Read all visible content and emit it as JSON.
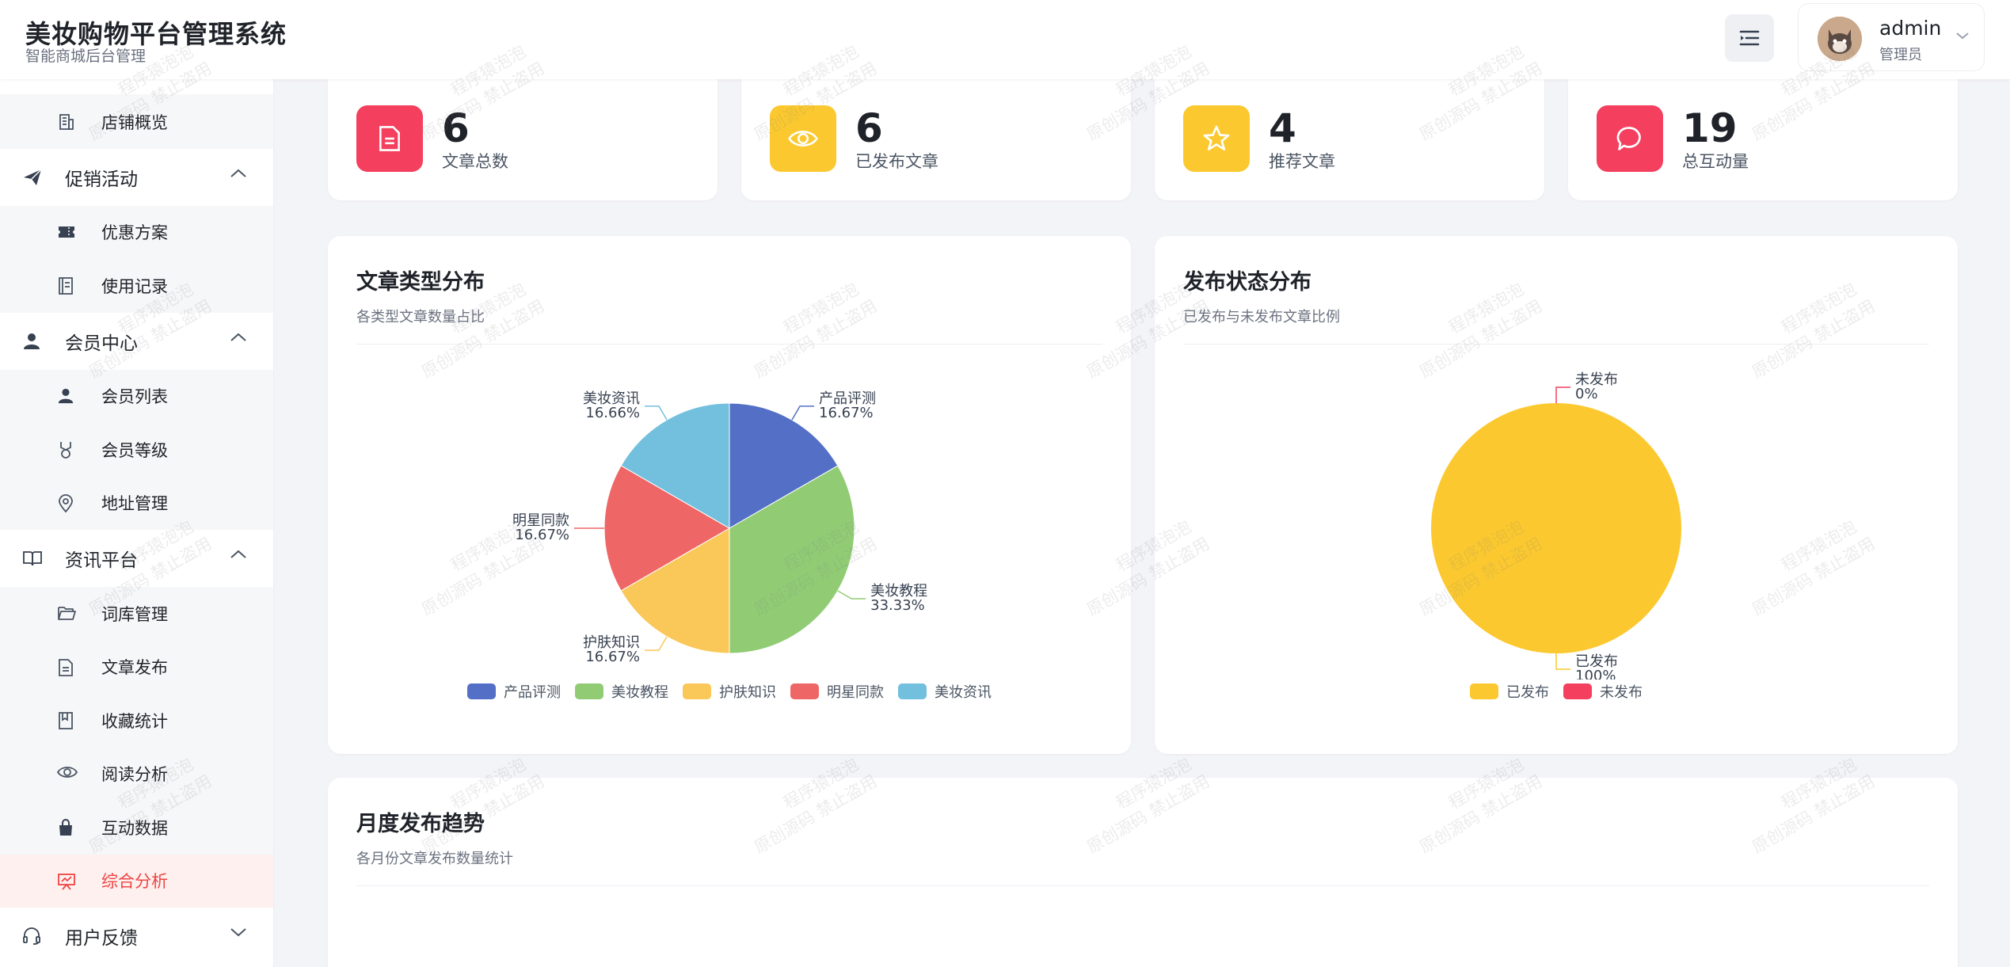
{
  "header": {
    "title": "美妆购物平台管理系统",
    "subtitle": "智能商城后台管理",
    "user_name": "admin",
    "user_role": "管理员"
  },
  "sidebar": {
    "partial_item": {
      "label": "店铺概览",
      "icon": "building-icon"
    },
    "groups": [
      {
        "label": "促销活动",
        "icon": "send-icon",
        "expanded": true,
        "items": [
          {
            "label": "优惠方案",
            "icon": "ticket-icon"
          },
          {
            "label": "使用记录",
            "icon": "record-icon"
          }
        ]
      },
      {
        "label": "会员中心",
        "icon": "user-icon",
        "expanded": true,
        "items": [
          {
            "label": "会员列表",
            "icon": "user-icon"
          },
          {
            "label": "会员等级",
            "icon": "medal-icon"
          },
          {
            "label": "地址管理",
            "icon": "location-icon"
          }
        ]
      },
      {
        "label": "资讯平台",
        "icon": "book-icon",
        "expanded": true,
        "items": [
          {
            "label": "词库管理",
            "icon": "folder-icon"
          },
          {
            "label": "文章发布",
            "icon": "document-icon"
          },
          {
            "label": "收藏统计",
            "icon": "bookmark-icon"
          },
          {
            "label": "阅读分析",
            "icon": "eye-icon"
          },
          {
            "label": "互动数据",
            "icon": "bag-icon"
          },
          {
            "label": "综合分析",
            "icon": "presentation-icon",
            "active": true
          }
        ]
      },
      {
        "label": "用户反馈",
        "icon": "headset-icon",
        "expanded": false
      }
    ]
  },
  "stats": [
    {
      "value": "6",
      "label": "文章总数",
      "icon": "document-icon",
      "color": "#f43f5e"
    },
    {
      "value": "6",
      "label": "已发布文章",
      "icon": "eye-icon",
      "color": "#fbbf24"
    },
    {
      "value": "4",
      "label": "推荐文章",
      "icon": "star-icon",
      "color": "#fbbf24"
    },
    {
      "value": "19",
      "label": "总互动量",
      "icon": "chat-icon",
      "color": "#f43f5e"
    }
  ],
  "panels": {
    "type_dist": {
      "title": "文章类型分布",
      "subtitle": "各类型文章数量占比"
    },
    "status_dist": {
      "title": "发布状态分布",
      "subtitle": "已发布与未发布文章比例"
    },
    "monthly": {
      "title": "月度发布趋势",
      "subtitle": "各月份文章发布数量统计"
    }
  },
  "chart_data": [
    {
      "type": "pie",
      "categories": [
        "产品评测",
        "美妆教程",
        "护肤知识",
        "明星同款",
        "美妆资讯"
      ],
      "values": [
        16.67,
        33.33,
        16.67,
        16.67,
        16.66
      ],
      "value_labels": [
        "16.67%",
        "33.33%",
        "16.67%",
        "16.67%",
        "16.66%"
      ],
      "colors": [
        "#5470c6",
        "#91cc75",
        "#fac858",
        "#ee6666",
        "#73c0de"
      ],
      "legend": "bottom"
    },
    {
      "type": "pie",
      "categories": [
        "已发布",
        "未发布"
      ],
      "values": [
        100,
        0
      ],
      "value_labels": [
        "100%",
        "0%"
      ],
      "colors": [
        "#fbc92f",
        "#f43f5e"
      ],
      "legend": "bottom"
    }
  ],
  "watermark": {
    "line1": "程序猿泡泡",
    "line2": "原创源码 禁止盗用"
  }
}
